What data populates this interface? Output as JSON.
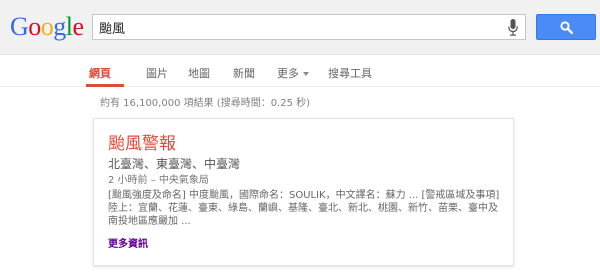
{
  "logo": {
    "letters": [
      "G",
      "o",
      "o",
      "g",
      "l",
      "e"
    ]
  },
  "search": {
    "query": "颱風"
  },
  "tabs": [
    {
      "label": "網頁"
    },
    {
      "label": "圖片"
    },
    {
      "label": "地圖"
    },
    {
      "label": "新聞"
    },
    {
      "label": "更多"
    },
    {
      "label": "搜尋工具"
    }
  ],
  "stats": {
    "text": "約有 16,100,000 項結果 (搜尋時間：0.25 秒)"
  },
  "card": {
    "title": "颱風警報",
    "subtitle": "北臺灣、東臺灣、中臺灣",
    "meta": "2 小時前 – 中央氣象局",
    "body": "[颱風強度及命名] 中度颱風，國際命名：SOULIK，中文譯名：蘇力 ... [警戒區域及事項] 陸上：宜蘭、花蓮、臺東、綠島、蘭嶼、基隆、臺北、新北、桃園、新竹、苗栗、臺中及南投地區應嚴加 ...",
    "more_link": "更多資訊"
  },
  "colors": {
    "logo_blue": "#3369e8",
    "logo_red": "#d50f25",
    "logo_yellow": "#eeb211",
    "logo_green": "#009925",
    "active_tab": "#dd4b39",
    "search_button": "#4b8bf5",
    "title": "#dd4b39",
    "link": "#660099"
  },
  "icons": {
    "mic": "microphone-icon",
    "search": "magnifier-icon",
    "caret": "caret-down-icon"
  }
}
